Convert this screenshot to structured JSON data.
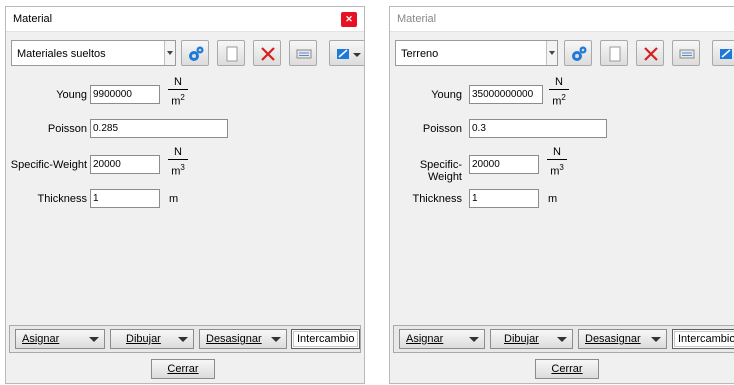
{
  "left": {
    "title": "Material",
    "combo_value": "Materiales sueltos",
    "fields": {
      "young_label": "Young",
      "young_value": "9900000",
      "poisson_label": "Poisson",
      "poisson_value": "0.285",
      "sw_label": "Specific-Weight",
      "sw_value": "20000",
      "thickness_label": "Thickness",
      "thickness_value": "1"
    },
    "buttons": {
      "asignar": "Asignar",
      "dibujar": "Dibujar",
      "desasignar": "Desasignar",
      "intercambio": "Intercambio",
      "cerrar": "Cerrar"
    }
  },
  "right": {
    "title": "Material",
    "combo_value": "Terreno",
    "fields": {
      "young_label": "Young",
      "young_value": "35000000000",
      "poisson_label": "Poisson",
      "poisson_value": "0.3",
      "sw_label": "Specific-Weight",
      "sw_value": "20000",
      "thickness_label": "Thickness",
      "thickness_value": "1"
    },
    "buttons": {
      "asignar": "Asignar",
      "dibujar": "Dibujar",
      "desasignar": "Desasignar",
      "intercambio": "Intercambio",
      "cerrar": "Cerrar"
    }
  },
  "units": {
    "n": "N",
    "m": "m",
    "sq": "2",
    "cu": "3",
    "meter": "m"
  },
  "icons": [
    "gears-icon",
    "document-icon",
    "delete-x-icon",
    "list-icon",
    "color-edit-icon"
  ],
  "colors": {
    "close_red": "#e81123",
    "gear_blue": "#1e7ad8",
    "delete_red": "#d42020"
  }
}
